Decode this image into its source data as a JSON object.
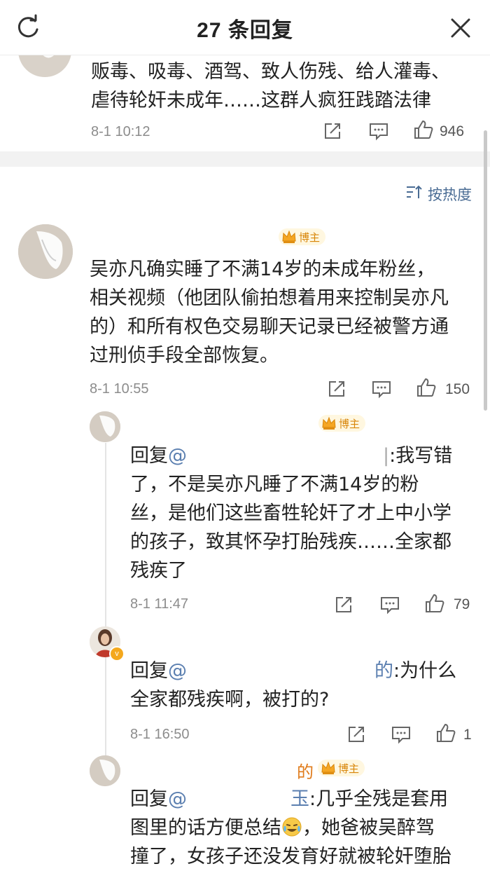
{
  "header": {
    "title": "27 条回复"
  },
  "top_comment": {
    "line1": "贩毒、吸毒、酒驾、致人伤残、给人灌毒、",
    "line2": "虐待轮奸未成年……这群人疯狂践踏法律",
    "time": "8-1 10:12",
    "likes": "946"
  },
  "sort": {
    "label": "按热度"
  },
  "main_comment": {
    "badge": "博主",
    "lines": [
      "吴亦凡确实睡了不满14岁的未成年粉丝，",
      "相关视频（他团队偷拍想着用来控制吴亦凡",
      "的）和所有权色交易聊天记录已经被警方通",
      "过刑侦手段全部恢复。"
    ],
    "time": "8-1 10:55",
    "likes": "150"
  },
  "replies": [
    {
      "badge": "博主",
      "prefix": "回复",
      "at": "@",
      "mention_tail": "",
      "after": ":我写错",
      "lines": [
        "了，不是吴亦凡睡了不满14岁的粉",
        "丝，是他们这些畜牲轮奸了才上中小学",
        "的孩子，致其怀孕打胎残疾……全家都",
        "残疾了"
      ],
      "time": "8-1 11:47",
      "likes": "79"
    },
    {
      "prefix": "回复",
      "at": "@",
      "mention_tail": "的",
      "after": ":为什么",
      "lines": [
        "全家都残疾啊，被打的?"
      ],
      "time": "8-1 16:50",
      "likes": "1"
    },
    {
      "name_tail": "的",
      "badge": "博主",
      "prefix": "回复",
      "at": "@",
      "mention_tail": "玉",
      "after": ":几乎全残是套用",
      "line2a": "图里的话方便总结",
      "line2b": "，她爸被吴醉驾",
      "line3": "撞了，女孩子还没发育好就被轮奸堕胎"
    }
  ],
  "icons": {
    "refresh": "refresh-icon",
    "close": "close-icon",
    "share": "share-icon",
    "comment": "comment-icon",
    "like": "like-icon",
    "sort": "sort-icon",
    "crown": "crown-icon",
    "emoji": "crying-laughing-emoji"
  },
  "colors": {
    "mention": "#5b7fb0",
    "badge_text": "#d8860a",
    "badge_bg": "#fff7e0"
  }
}
